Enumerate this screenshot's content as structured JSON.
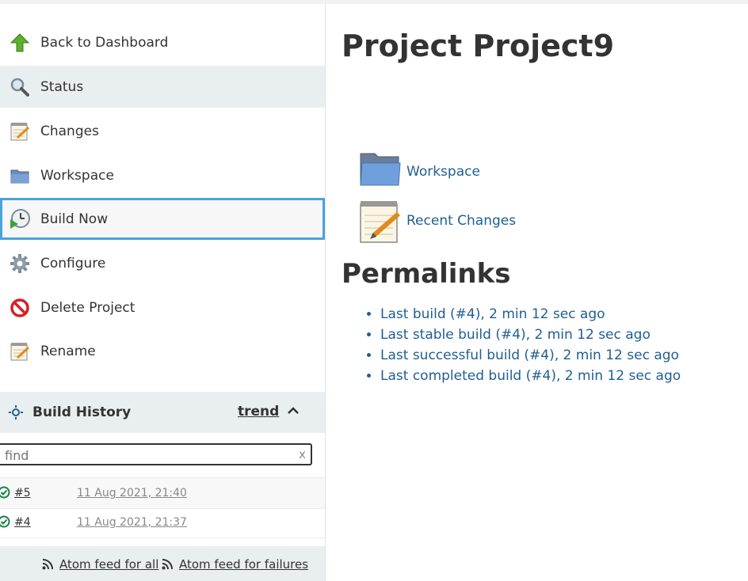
{
  "sidebar": {
    "tasks": [
      {
        "label": "Back to Dashboard",
        "icon": "up-arrow-icon"
      },
      {
        "label": "Status",
        "icon": "magnifier-icon"
      },
      {
        "label": "Changes",
        "icon": "notepad-icon"
      },
      {
        "label": "Workspace",
        "icon": "folder-icon"
      },
      {
        "label": "Build Now",
        "icon": "clock-play-icon"
      },
      {
        "label": "Configure",
        "icon": "gear-icon"
      },
      {
        "label": "Delete Project",
        "icon": "no-entry-icon"
      },
      {
        "label": "Rename",
        "icon": "notepad-icon"
      }
    ]
  },
  "build_history": {
    "title": "Build History",
    "trend_label": "trend",
    "search_placeholder": "find",
    "clear_label": "x",
    "builds": [
      {
        "number": "#5",
        "date": "11 Aug 2021, 21:40",
        "status": "success"
      },
      {
        "number": "#4",
        "date": "11 Aug 2021, 21:37",
        "status": "success"
      }
    ],
    "feed_all": "Atom feed for all",
    "feed_failures": "Atom feed for failures"
  },
  "main": {
    "title": "Project Project9",
    "workspace_link": "Workspace",
    "recent_changes_link": "Recent Changes",
    "permalinks_heading": "Permalinks",
    "permalinks": [
      "Last build (#4), 2 min 12 sec ago",
      "Last stable build (#4), 2 min 12 sec ago",
      "Last successful build (#4), 2 min 12 sec ago",
      "Last completed build (#4), 2 min 12 sec ago"
    ]
  },
  "colors": {
    "link": "#1f5e93",
    "focus_border": "#4aa3dc",
    "panel_bg": "#e9eef1",
    "success": "#138347"
  }
}
